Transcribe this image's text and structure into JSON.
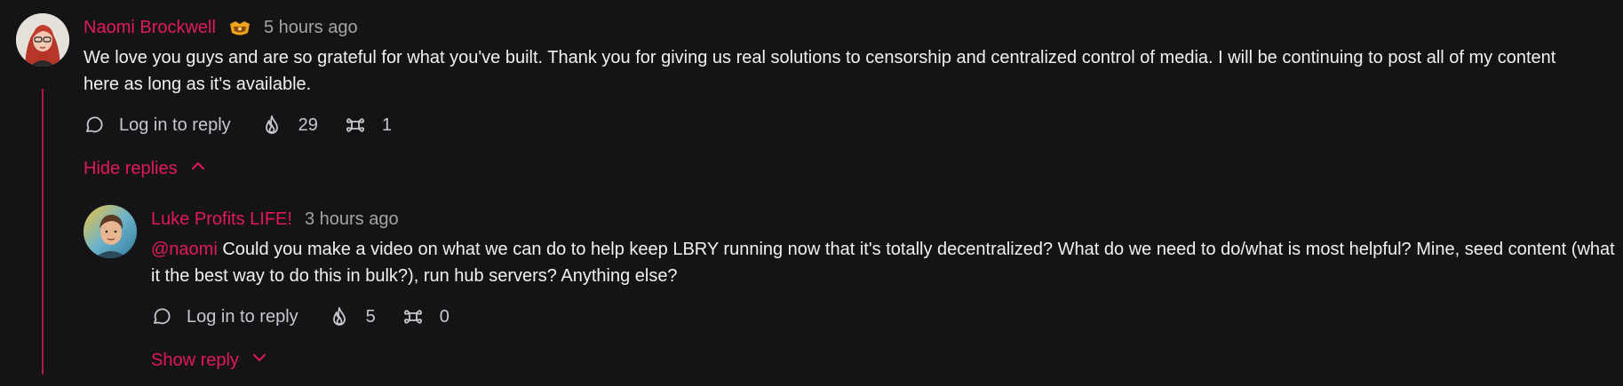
{
  "comments": {
    "top": {
      "author": "Naomi Brockwell",
      "timestamp": "5 hours ago",
      "body": "We love you guys and are so grateful for what you've built. Thank you for giving us real solutions to censorship and centralized control of media. I will be continuing to post all of my content here as long as it's available.",
      "reply_label": "Log in to reply",
      "fire_count": "29",
      "slime_count": "1",
      "toggle_label": "Hide replies"
    },
    "reply": {
      "author": "Luke Profits LIFE!",
      "timestamp": "3 hours ago",
      "mention": "@naomi",
      "body": " Could you make a video on what we can do to help keep LBRY running now that it's totally decentralized? What do we need to do/what is most helpful? Mine, seed content (what it the best way to do this in bulk?), run hub servers? Anything else?",
      "reply_label": "Log in to reply",
      "fire_count": "5",
      "slime_count": "0",
      "toggle_label": "Show reply"
    }
  },
  "icons": {
    "reply": "comment-bubble-icon",
    "fire": "fire-icon",
    "slime": "slime-icon",
    "badge": "creator-badge-icon",
    "chevron_up": "chevron-up-icon",
    "chevron_down": "chevron-down-icon"
  },
  "colors": {
    "background": "#141416",
    "accent": "#e2195c",
    "text": "#f1f1f1",
    "muted": "#a5a5a8"
  }
}
